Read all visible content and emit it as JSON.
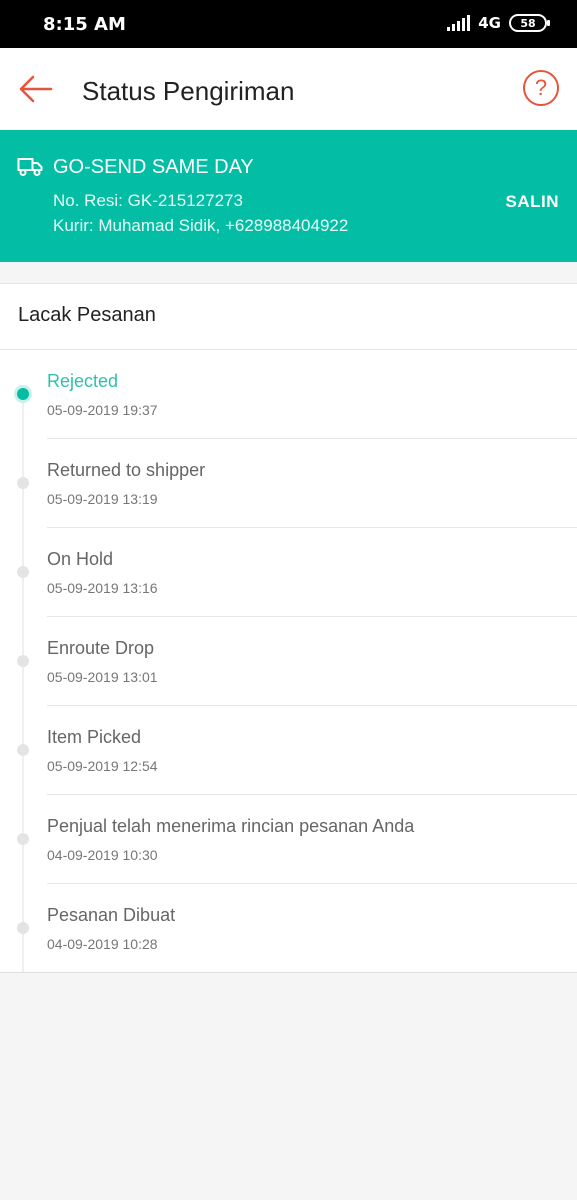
{
  "status_bar": {
    "time": "8:15 AM",
    "network": "4G",
    "battery": "58"
  },
  "app_bar": {
    "title": "Status Pengiriman",
    "help_label": "?"
  },
  "shipping": {
    "courier": "GO-SEND SAME DAY",
    "resi": "No. Resi: GK-215127273",
    "kurir": "Kurir: Muhamad Sidik, +628988404922",
    "copy_label": "SALIN"
  },
  "tracking": {
    "header": "Lacak Pesanan",
    "events": [
      {
        "title": "Rejected",
        "time": "05-09-2019 19:37"
      },
      {
        "title": "Returned to shipper",
        "time": "05-09-2019 13:19"
      },
      {
        "title": "On Hold",
        "time": "05-09-2019 13:16"
      },
      {
        "title": "Enroute Drop",
        "time": "05-09-2019 13:01"
      },
      {
        "title": "Item Picked",
        "time": "05-09-2019 12:54"
      },
      {
        "title": "Penjual telah menerima rincian pesanan Anda",
        "time": "04-09-2019 10:30"
      },
      {
        "title": "Pesanan Dibuat",
        "time": "04-09-2019 10:28"
      }
    ]
  },
  "colors": {
    "accent": "#03bea4",
    "brand_orange": "#e6553a"
  }
}
